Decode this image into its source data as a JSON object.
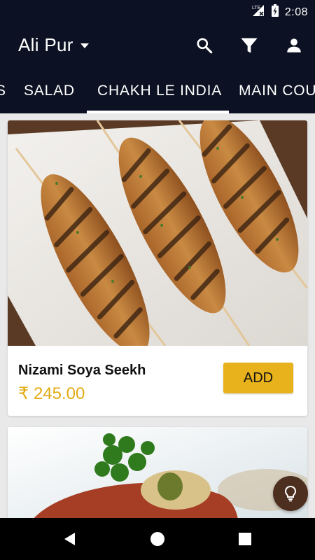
{
  "status_bar": {
    "network": "LTE",
    "time": "2:08",
    "icons": [
      "lte-signal-icon",
      "battery-charging-icon"
    ]
  },
  "header": {
    "location": "Ali Pur",
    "icons": [
      "chevron-down-icon",
      "search-icon",
      "filter-icon",
      "account-icon"
    ]
  },
  "tabs": [
    {
      "label": "S"
    },
    {
      "label": "SALAD"
    },
    {
      "label": "CHAKH LE INDIA",
      "active": true
    },
    {
      "label": "MAIN COU"
    }
  ],
  "items": [
    {
      "name": "Nizami Soya Seekh",
      "price": "₹ 245.00",
      "button": "ADD"
    }
  ],
  "fab": {
    "icon": "lightbulb-icon"
  },
  "colors": {
    "app_bar": "#0c1223",
    "accent": "#e8b21c",
    "price": "#e2ab14",
    "fab": "#4d2f20"
  },
  "nav": {
    "icons": [
      "back-icon",
      "home-icon",
      "recents-icon"
    ]
  }
}
